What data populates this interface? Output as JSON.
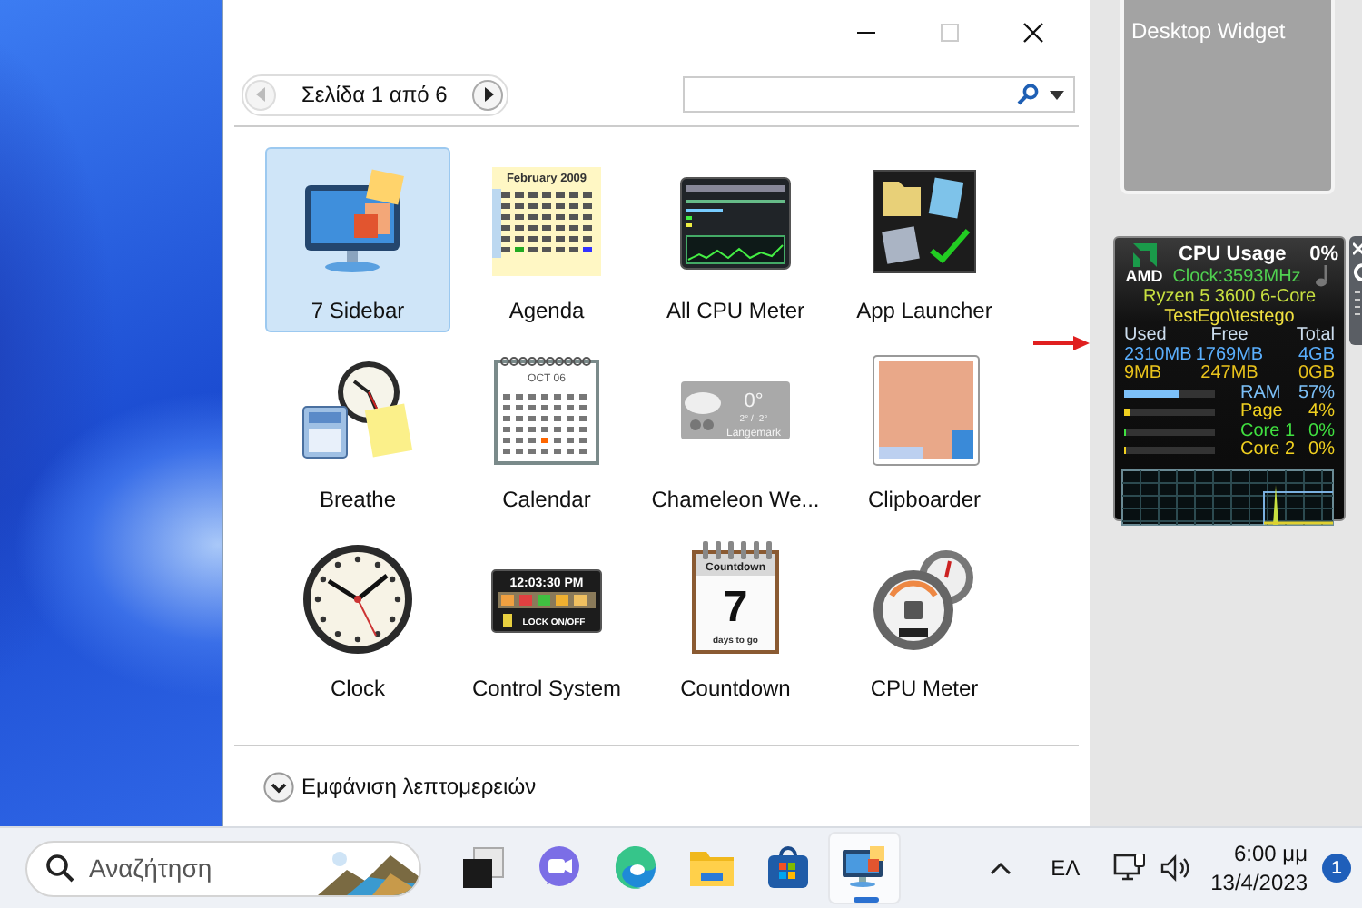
{
  "window": {
    "pager": {
      "label": "Σελίδα 1 από 6",
      "prev_disabled": true,
      "next_disabled": false
    },
    "gadgets": [
      {
        "label": "7 Sidebar",
        "selected": true,
        "kind": "sidebar"
      },
      {
        "label": "Agenda",
        "selected": false,
        "kind": "agenda",
        "thumb_texts": [
          "February 2009"
        ]
      },
      {
        "label": "All CPU Meter",
        "selected": false,
        "kind": "all-cpu"
      },
      {
        "label": "App Launcher",
        "selected": false,
        "kind": "launcher"
      },
      {
        "label": "Breathe",
        "selected": false,
        "kind": "breathe"
      },
      {
        "label": "Calendar",
        "selected": false,
        "kind": "calendar",
        "thumb_texts": [
          "OCT 06"
        ]
      },
      {
        "label": "Chameleon We...",
        "selected": false,
        "kind": "weather",
        "thumb_texts": [
          "0°",
          "2° / -2°",
          "Langemark"
        ]
      },
      {
        "label": "Clipboarder",
        "selected": false,
        "kind": "photo-frame"
      },
      {
        "label": "Clock",
        "selected": false,
        "kind": "clock"
      },
      {
        "label": "Control System",
        "selected": false,
        "kind": "control",
        "thumb_texts": [
          "12:03:30 PM",
          "LOCK ON/OFF"
        ]
      },
      {
        "label": "Countdown",
        "selected": false,
        "kind": "countdown",
        "thumb_texts": [
          "Countdown",
          "7",
          "days to go"
        ]
      },
      {
        "label": "CPU Meter",
        "selected": false,
        "kind": "gauges"
      }
    ],
    "details_toggle": "Εμφάνιση λεπτομερειών"
  },
  "sidebar": {
    "tile": "Desktop Widget",
    "cpu_widget": {
      "brand": "AMD",
      "title": "CPU Usage",
      "usage": "0%",
      "clock": "Clock:3593MHz",
      "model": "Ryzen 5 3600 6-Core",
      "user": "TestEgo\\testego",
      "headers": [
        "Used",
        "Free",
        "Total"
      ],
      "memory_rows": [
        {
          "color": "#5aaefc",
          "values": [
            "2310MB",
            "1769MB",
            "4GB"
          ]
        },
        {
          "color": "#e8c21c",
          "values": [
            "9MB",
            "247MB",
            "0GB"
          ]
        }
      ],
      "meters": [
        {
          "label": "RAM",
          "reading": "57%",
          "level": 0.57,
          "color": "#7cc0f8"
        },
        {
          "label": "Page",
          "reading": "4%",
          "level": 0.04,
          "color": "#f0d020"
        },
        {
          "label": "Core 1",
          "reading": "0%",
          "level": 0,
          "color": "#40e040"
        },
        {
          "label": "Core 2",
          "reading": "0%",
          "level": 0,
          "color": "#f0d020"
        }
      ]
    }
  },
  "taskbar": {
    "search": {
      "placeholder": "Αναζήτηση"
    },
    "apps": [
      {
        "kind": "task-view",
        "active": false
      },
      {
        "kind": "chat",
        "active": false
      },
      {
        "kind": "browser",
        "active": false
      },
      {
        "kind": "folder",
        "active": false
      },
      {
        "kind": "store",
        "active": false
      },
      {
        "kind": "gadgets",
        "active": true
      }
    ],
    "language": "ΕΛ",
    "time": "6:00 μμ",
    "date": "13/4/2023",
    "notifications": "1"
  }
}
